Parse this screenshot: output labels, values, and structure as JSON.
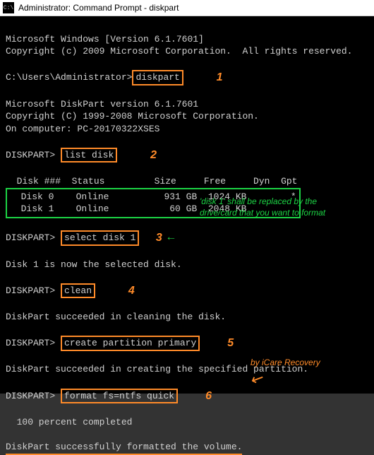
{
  "title_bar": {
    "icon_text": "C:\\",
    "title": "Administrator: Command Prompt - diskpart"
  },
  "header": {
    "version_line": "Microsoft Windows [Version 6.1.7601]",
    "copyright_line": "Copyright (c) 2009 Microsoft Corporation.  All rights reserved."
  },
  "cmd1": {
    "prompt": "C:\\Users\\Administrator>",
    "command": "diskpart",
    "num": "1"
  },
  "diskpart_header": {
    "line1": "Microsoft DiskPart version 6.1.7601",
    "line2": "Copyright (C) 1999-2008 Microsoft Corporation.",
    "line3": "On computer: PC-20170322XSES"
  },
  "cmd2": {
    "prompt": "DISKPART>",
    "command": "list disk",
    "num": "2"
  },
  "table": {
    "header": "  Disk ###  Status         Size     Free     Dyn  Gpt",
    "rows": [
      "Disk 0    Online          931 GB  1024 KB        *",
      "Disk 1    Online           60 GB  2048 KB         "
    ]
  },
  "cmd3": {
    "prompt": "DISKPART>",
    "command": "select disk 1",
    "num": "3",
    "note_line1": "'disk 1' shall be replaced by the",
    "note_line2": "drive/card that you want to format",
    "result": "Disk 1 is now the selected disk."
  },
  "cmd4": {
    "prompt": "DISKPART>",
    "command": "clean",
    "num": "4",
    "result": "DiskPart succeeded in cleaning the disk."
  },
  "cmd5": {
    "prompt": "DISKPART>",
    "command": "create partition primary",
    "num": "5",
    "result": "DiskPart succeeded in creating the specified partition."
  },
  "cmd6": {
    "prompt": "DISKPART>",
    "command": "format fs=ntfs quick",
    "num": "6",
    "progress": "  100 percent completed",
    "result": "DiskPart successfully formatted the volume."
  },
  "credit": "by iCare Recovery"
}
